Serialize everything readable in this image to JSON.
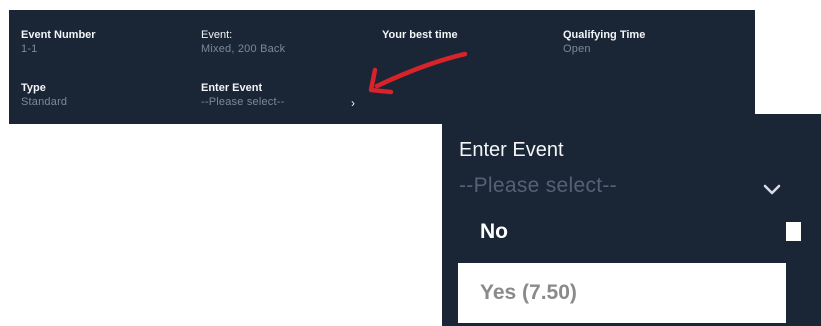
{
  "event_details": {
    "event_number": {
      "label": "Event Number",
      "value": "1-1"
    },
    "event": {
      "label": "Event:",
      "value": "Mixed, 200 Back"
    },
    "best_time": {
      "label": "Your best time",
      "value": ""
    },
    "qualifying_time": {
      "label": "Qualifying Time",
      "value": "Open"
    },
    "type": {
      "label": "Type",
      "value": "Standard"
    },
    "enter_event": {
      "label": "Enter Event",
      "placeholder": "--Please select--"
    }
  },
  "zoomed_dropdown": {
    "label": "Enter Event",
    "placeholder": "--Please select--",
    "options": [
      "No",
      "Yes (7.50)"
    ]
  },
  "colors": {
    "panel_bg": "#1a2535",
    "label_text": "#f3f5f8",
    "value_text": "#7d8898",
    "annotation_arrow": "#d8232a"
  },
  "icons": {
    "select_chevron": "chevron-down-icon",
    "annotation": "red-arrow-annotation"
  }
}
